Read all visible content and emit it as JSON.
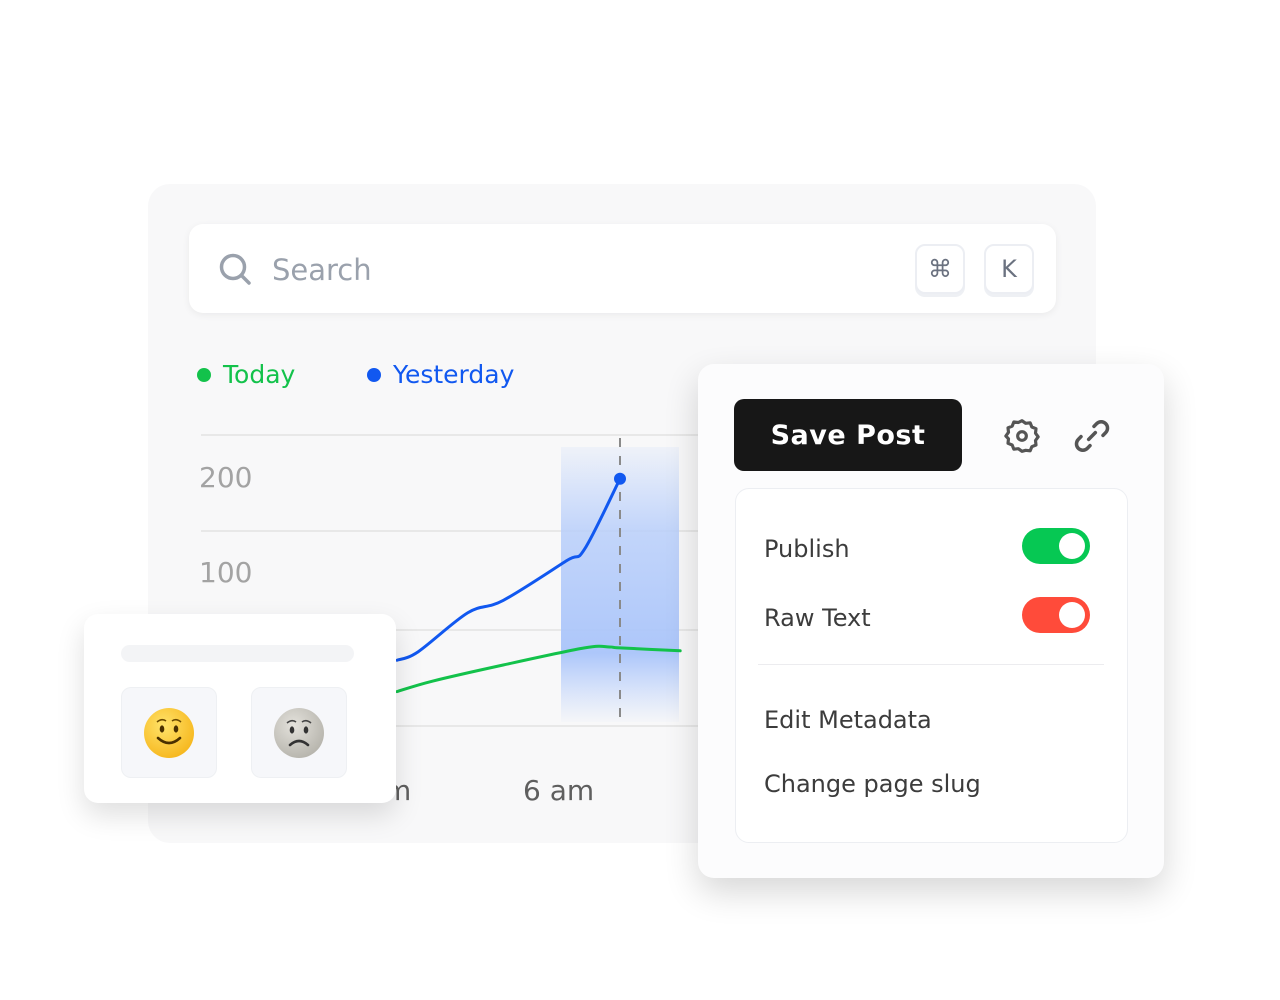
{
  "search": {
    "placeholder": "Search",
    "icon": "search-icon",
    "shortcut_keys": [
      "⌘",
      "K"
    ]
  },
  "colors": {
    "today": "#13c24b",
    "yesterday": "#1158f0",
    "highlight": "#b9cffa",
    "save_button_bg": "#171717",
    "toggle_on_green": "#06c853",
    "toggle_on_red": "#ff4b3a"
  },
  "chart_data": {
    "type": "line",
    "title": "",
    "xlabel": "",
    "ylabel": "",
    "legend": {
      "position": "top-left",
      "entries": [
        "Today",
        "Yesterday"
      ]
    },
    "y_ticks": [
      {
        "value": 200,
        "label": "200"
      },
      {
        "value": 100,
        "label": "100"
      }
    ],
    "gridlines": [
      250,
      150,
      45,
      -55
    ],
    "grid": true,
    "ylim": [
      -65,
      255
    ],
    "xlim": [
      0,
      10
    ],
    "x_ticks": [
      {
        "value": 0,
        "label": "m"
      },
      {
        "value": 6,
        "label": "6 am"
      }
    ],
    "series": [
      {
        "name": "Yesterday",
        "color": "#1158f0",
        "points": [
          [
            0,
            5
          ],
          [
            0.6,
            14
          ],
          [
            2.0,
            55
          ],
          [
            3.0,
            68
          ],
          [
            4.8,
            110
          ],
          [
            5.3,
            122
          ],
          [
            6.3,
            196
          ]
        ],
        "end_marker": true
      },
      {
        "name": "Today",
        "color": "#13c24b",
        "points": [
          [
            0,
            -28
          ],
          [
            1.0,
            -17
          ],
          [
            3.0,
            0
          ],
          [
            5.3,
            18
          ],
          [
            6.0,
            19
          ],
          [
            6.3,
            18
          ],
          [
            8.0,
            15
          ]
        ]
      }
    ],
    "highlight_band": {
      "from": 5.3,
      "to": 9.0
    },
    "cursor_x": 6.3
  },
  "feedback": {
    "options": [
      {
        "name": "happy",
        "glyph": "🙂"
      },
      {
        "name": "sad",
        "glyph": "🙁"
      }
    ]
  },
  "panel": {
    "save_label": "Save Post",
    "settings_icon": "gear-icon",
    "link_icon": "link-icon",
    "toggles": [
      {
        "label": "Publish",
        "on": true,
        "color": "#06c853"
      },
      {
        "label": "Raw Text",
        "on": true,
        "color": "#ff4b3a"
      }
    ],
    "actions": [
      {
        "label": "Edit Metadata"
      },
      {
        "label": "Change page slug"
      }
    ]
  }
}
